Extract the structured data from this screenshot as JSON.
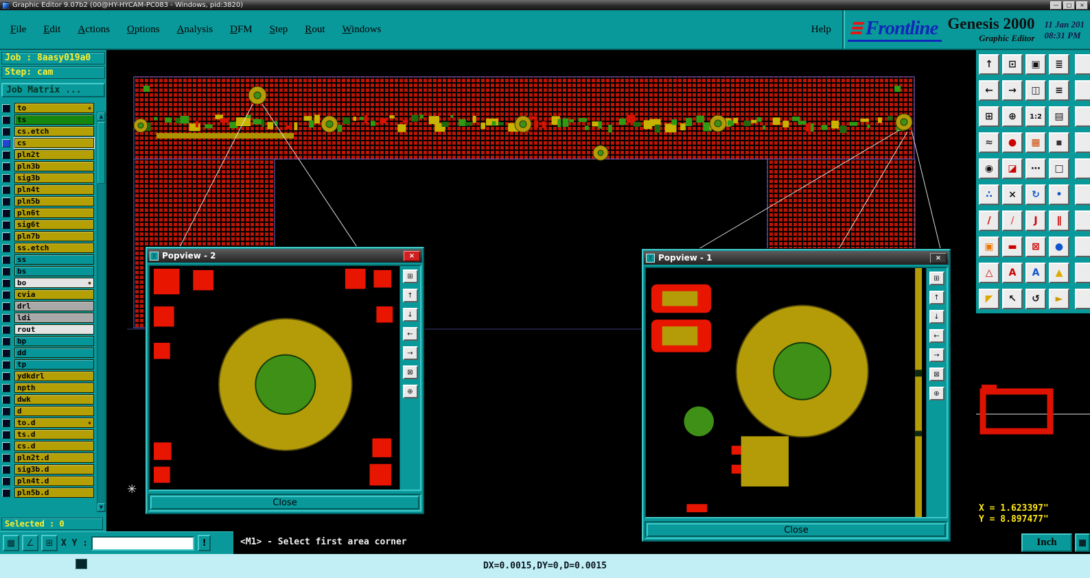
{
  "titlebar": {
    "title": "Graphic Editor 9.07b2 (00@HY-HYCAM-PC083 - Windows, pid:3820)",
    "minimize": "—",
    "maximize": "□",
    "close": "×"
  },
  "menu": {
    "items": [
      "File",
      "Edit",
      "Actions",
      "Options",
      "Analysis",
      "DFM",
      "Step",
      "Rout",
      "Windows"
    ],
    "help": "Help"
  },
  "brand": {
    "name": "Frontline",
    "product": "Genesis 2000",
    "date": "11 Jan 201",
    "time": "08:31 PM",
    "subtitle": "Graphic Editor"
  },
  "left_panel": {
    "job": "Job : 8aasy019a0",
    "step": "Step: cam",
    "matrix": "Job Matrix ...",
    "selected": "Selected : 0",
    "layers": [
      {
        "name": "to",
        "color": "olive",
        "marker": true
      },
      {
        "name": "ts",
        "color": "green"
      },
      {
        "name": "cs.etch",
        "color": "olive"
      },
      {
        "name": "cs",
        "color": "olive",
        "active": true
      },
      {
        "name": "pln2t",
        "color": "olive"
      },
      {
        "name": "pln3b",
        "color": "olive"
      },
      {
        "name": "sig3b",
        "color": "olive"
      },
      {
        "name": "pln4t",
        "color": "olive"
      },
      {
        "name": "pln5b",
        "color": "olive"
      },
      {
        "name": "pln6t",
        "color": "olive"
      },
      {
        "name": "sig6t",
        "color": "olive"
      },
      {
        "name": "pln7b",
        "color": "olive"
      },
      {
        "name": "ss.etch",
        "color": "olive"
      },
      {
        "name": "ss",
        "color": "teal"
      },
      {
        "name": "bs",
        "color": "teal"
      },
      {
        "name": "bo",
        "color": "white",
        "marker": true
      },
      {
        "name": "cvia",
        "color": "olive"
      },
      {
        "name": "drl",
        "color": "gray"
      },
      {
        "name": "ldi",
        "color": "gray"
      },
      {
        "name": "rout",
        "color": "white"
      },
      {
        "name": "bp",
        "color": "teal"
      },
      {
        "name": "dd",
        "color": "teal"
      },
      {
        "name": "tp",
        "color": "teal"
      },
      {
        "name": "ydkdrl",
        "color": "olive"
      },
      {
        "name": "npth",
        "color": "olive"
      },
      {
        "name": "dwk",
        "color": "olive"
      },
      {
        "name": "d",
        "color": "olive"
      },
      {
        "name": "to.d",
        "color": "olive",
        "marker": true
      },
      {
        "name": "ts.d",
        "color": "olive"
      },
      {
        "name": "cs.d",
        "color": "olive"
      },
      {
        "name": "pln2t.d",
        "color": "olive"
      },
      {
        "name": "sig3b.d",
        "color": "olive"
      },
      {
        "name": "pln4t.d",
        "color": "olive"
      },
      {
        "name": "pln5b.d",
        "color": "olive"
      }
    ]
  },
  "statusbar": {
    "xy": "X Y :",
    "input": "",
    "bang": "!",
    "prompt": "<M1> - Select first area corner",
    "units": "Inch"
  },
  "bottombar": {
    "readout": "DX=0.0015,DY=0,D=0.0015"
  },
  "coords": {
    "x": "X = 1.623397\"",
    "y": "Y = 8.897477\""
  },
  "popviews": [
    {
      "title": "Popview - 2",
      "close_label": "Close",
      "close_glyph": "×"
    },
    {
      "title": "Popview - 1",
      "close_label": "Close",
      "close_glyph": "×"
    }
  ],
  "right_toolbar": {
    "buttons": [
      {
        "name": "popview-tool",
        "glyph": "↑",
        "color": "#111"
      },
      {
        "name": "redraw-screen-tool",
        "glyph": "⊡",
        "color": "#111"
      },
      {
        "name": "cascade-view-tool",
        "glyph": "▣",
        "color": "#111"
      },
      {
        "name": "layer-display-tool",
        "glyph": "≣",
        "color": "#111"
      },
      {
        "name": "pan-left-tool",
        "glyph": "←",
        "color": "#111"
      },
      {
        "name": "pan-right-tool",
        "glyph": "→",
        "color": "#111"
      },
      {
        "name": "side-view-tool",
        "glyph": "◫",
        "color": "#111"
      },
      {
        "name": "feature-list-tool",
        "glyph": "≡",
        "color": "#111"
      },
      {
        "name": "zoom-window-tool",
        "glyph": "⊞",
        "color": "#111"
      },
      {
        "name": "zoom-center-tool",
        "glyph": "⊕",
        "color": "#111"
      },
      {
        "name": "zoom-1-2-tool",
        "glyph": "1:2",
        "color": "#111"
      },
      {
        "name": "grid-toggle-tool",
        "glyph": "▤",
        "color": "#111"
      },
      {
        "name": "compare-layers-tool",
        "glyph": "≈",
        "color": "#333"
      },
      {
        "name": "symbol-trace-tool",
        "glyph": "●",
        "color": "#c00"
      },
      {
        "name": "color-map-tool",
        "glyph": "▦",
        "color": "#c40"
      },
      {
        "name": "small-symbol-tool",
        "glyph": "▪",
        "color": "#333"
      },
      {
        "name": "center-point-tool",
        "glyph": "◉",
        "color": "#111"
      },
      {
        "name": "contrast-fill-tool",
        "glyph": "◪",
        "color": "#c00"
      },
      {
        "name": "dotted-line-tool",
        "glyph": "⋯",
        "color": "#111"
      },
      {
        "name": "frame-tool",
        "glyph": "□",
        "color": "#111"
      },
      {
        "name": "net-points-tool",
        "glyph": "∴",
        "color": "#15c"
      },
      {
        "name": "delete-feature-tool",
        "glyph": "×",
        "color": "#111"
      },
      {
        "name": "rotate-feature-tool",
        "glyph": "↻",
        "color": "#15c"
      },
      {
        "name": "add-point-tool",
        "glyph": "•",
        "color": "#15c"
      },
      {
        "name": "line-45-tool",
        "glyph": "/",
        "color": "#c00"
      },
      {
        "name": "thin-line-tool",
        "glyph": "/",
        "color": "#e55"
      },
      {
        "name": "arc-tool",
        "glyph": "J",
        "color": "#c00"
      },
      {
        "name": "parallel-lines-tool",
        "glyph": "∥",
        "color": "#c00"
      },
      {
        "name": "add-pad-tool",
        "glyph": "▣",
        "color": "#e70"
      },
      {
        "name": "red-trace-tool",
        "glyph": "▬",
        "color": "#c00"
      },
      {
        "name": "erase-area-tool",
        "glyph": "⊠",
        "color": "#c00"
      },
      {
        "name": "add-via-tool",
        "glyph": "●",
        "color": "#15c"
      },
      {
        "name": "triangle-outline-tool",
        "glyph": "△",
        "color": "#c00"
      },
      {
        "name": "red-text-tool",
        "glyph": "A",
        "color": "#c00"
      },
      {
        "name": "blue-text-tool",
        "glyph": "A",
        "color": "#15c"
      },
      {
        "name": "warning-triangle-tool",
        "glyph": "▲",
        "color": "#da0"
      },
      {
        "name": "select-cursor-tool",
        "glyph": "◤",
        "color": "#e0a800"
      },
      {
        "name": "pick-cursor-tool",
        "glyph": "↖",
        "color": "#111"
      },
      {
        "name": "rotate-cursor-tool",
        "glyph": "↺",
        "color": "#111"
      },
      {
        "name": "next-cursor-tool",
        "glyph": "►",
        "color": "#c90"
      }
    ]
  },
  "popview_tools": [
    {
      "name": "pv-zoom-window",
      "glyph": "⊞"
    },
    {
      "name": "pv-pan-up",
      "glyph": "↑"
    },
    {
      "name": "pv-pan-down",
      "glyph": "↓"
    },
    {
      "name": "pv-pan-left",
      "glyph": "←"
    },
    {
      "name": "pv-pan-right",
      "glyph": "→"
    },
    {
      "name": "pv-zoom-out",
      "glyph": "⊠"
    },
    {
      "name": "pv-zoom-center",
      "glyph": "⊕"
    }
  ],
  "status_icons": [
    {
      "name": "grid-snap",
      "glyph": "▦"
    },
    {
      "name": "angle-measure",
      "glyph": "∠"
    },
    {
      "name": "origin-grid",
      "glyph": "⊞"
    }
  ],
  "palette": {
    "olive": "#b4a005",
    "green": "#16870e",
    "teal": "#069599",
    "white": "#e4e4e4",
    "gray": "#a9a9a9"
  }
}
